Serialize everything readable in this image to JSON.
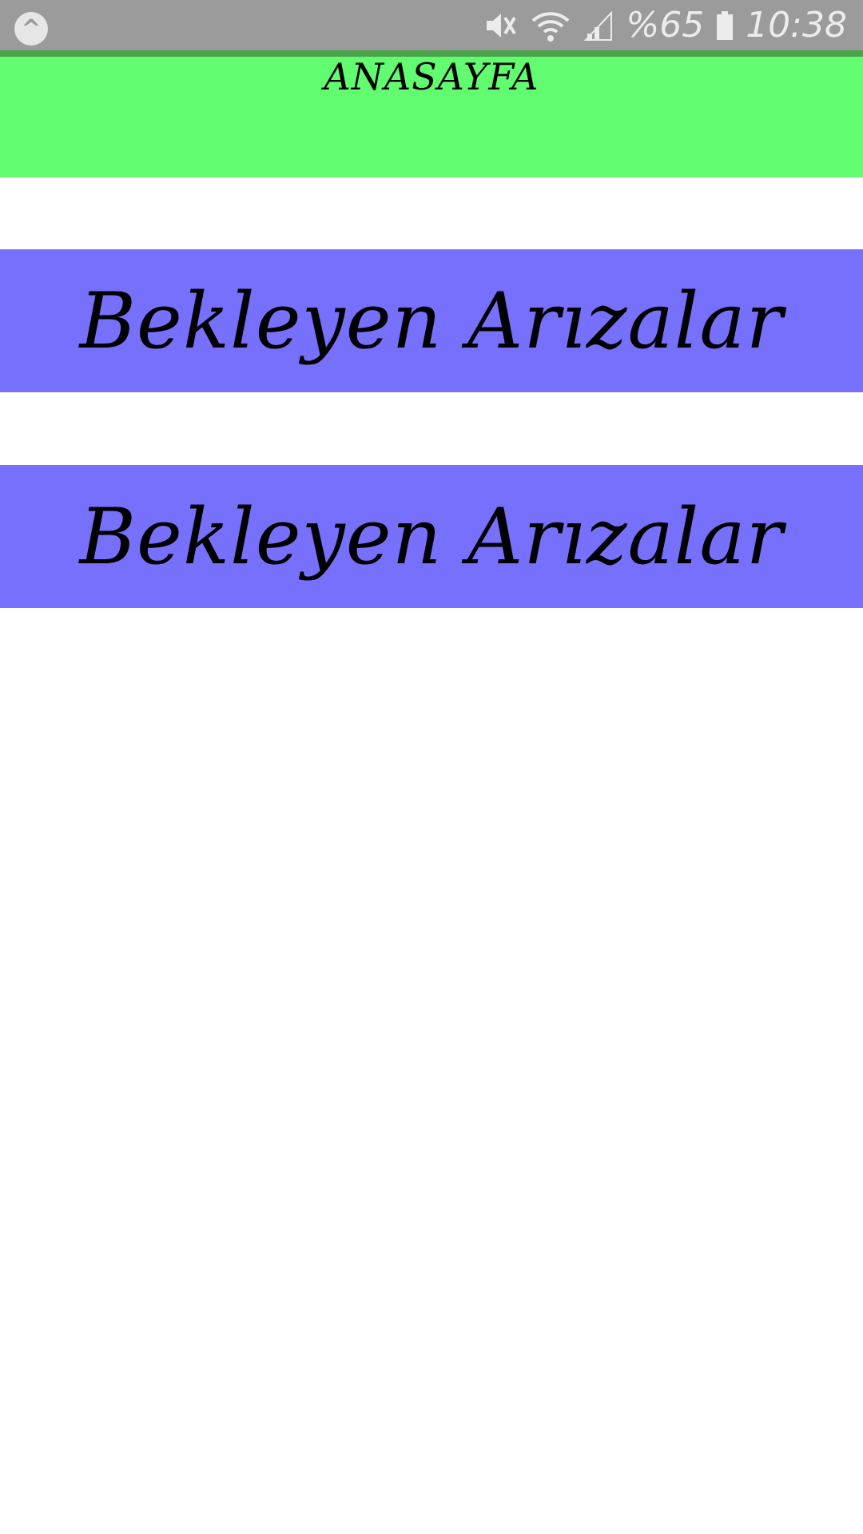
{
  "status_bar": {
    "notif_glyph": "^",
    "battery_text": "%65",
    "time": "10:38",
    "icons": [
      "mute-icon",
      "wifi-icon",
      "signal-icon",
      "battery-icon"
    ],
    "background_color": "#9b9b9b",
    "accent_line_color": "#4aa24a"
  },
  "header": {
    "title": "ANASAYFA",
    "background_color": "#62fc70"
  },
  "buttons": [
    {
      "label": "Bekleyen Arızalar",
      "background_color": "#7670fd"
    },
    {
      "label": "Bekleyen Arızalar",
      "background_color": "#7670fd"
    }
  ]
}
